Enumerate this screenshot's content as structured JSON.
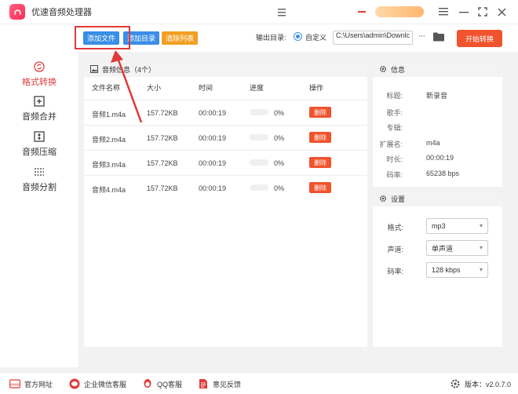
{
  "app": {
    "title": "优速音频处理器"
  },
  "toolbar": {
    "add_file": "添加文件",
    "add_dir": "添加目录",
    "clear_list": "清除列表",
    "output_label": "输出目录:",
    "custom_option": "自定义",
    "output_path": "C:\\Users\\admin\\Downlc",
    "more": "···",
    "start": "开始转换"
  },
  "sidebar": {
    "items": [
      {
        "label": "格式转换",
        "icon": "refresh-icon",
        "active": true
      },
      {
        "label": "音频合并",
        "icon": "merge-icon",
        "active": false
      },
      {
        "label": "音频压缩",
        "icon": "compress-icon",
        "active": false
      },
      {
        "label": "音频分割",
        "icon": "split-icon",
        "active": false
      }
    ]
  },
  "file_list": {
    "header": "音频信息（4个）",
    "columns": [
      "文件名称",
      "大小",
      "时间",
      "进度",
      "操作"
    ],
    "rows": [
      {
        "name": "音频1.m4a",
        "size": "157.72KB",
        "time": "00:00:19",
        "progress": "0%",
        "action": "删除"
      },
      {
        "name": "音频2.m4a",
        "size": "157.72KB",
        "time": "00:00:19",
        "progress": "0%",
        "action": "删除"
      },
      {
        "name": "音频3.m4a",
        "size": "157.72KB",
        "time": "00:00:19",
        "progress": "0%",
        "action": "删除"
      },
      {
        "name": "音频4.m4a",
        "size": "157.72KB",
        "time": "00:00:19",
        "progress": "0%",
        "action": "删除"
      }
    ]
  },
  "info": {
    "header": "信息",
    "fields": [
      {
        "key": "标题:",
        "value": "新录音"
      },
      {
        "key": "歌手:",
        "value": ""
      },
      {
        "key": "专辑:",
        "value": ""
      },
      {
        "key": "扩展名:",
        "value": "m4a"
      },
      {
        "key": "时长:",
        "value": "00:00:19"
      },
      {
        "key": "码率:",
        "value": "65238 bps"
      }
    ]
  },
  "settings": {
    "header": "设置",
    "fields": [
      {
        "key": "格式:",
        "value": "mp3"
      },
      {
        "key": "声道:",
        "value": "单声道"
      },
      {
        "key": "码率:",
        "value": "128 kbps"
      }
    ]
  },
  "statusbar": {
    "website": "官方网址",
    "wechat": "企业微信客服",
    "qq": "QQ客服",
    "feedback": "意见反馈",
    "version": "版本：v2.0.7.0"
  },
  "colors": {
    "accent": "#3a8ee6",
    "danger": "#f0532d",
    "warning": "#f2a023",
    "active": "#e23b3b"
  }
}
